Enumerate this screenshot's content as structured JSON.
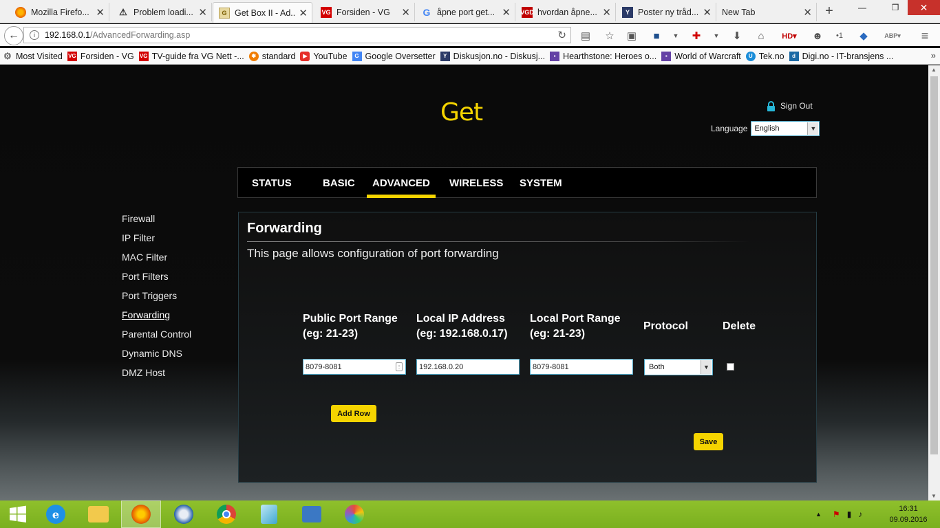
{
  "browser": {
    "tabs": [
      {
        "title": "Mozilla Firefo...",
        "favicon": "firefox-icon",
        "color": "#e66000"
      },
      {
        "title": "Problem loadi...",
        "favicon": "warning-icon",
        "color": "#f0c000"
      },
      {
        "title": "Get Box II - Ad...",
        "favicon": "get-icon",
        "color": "#e0c060"
      },
      {
        "title": "Forsiden - VG",
        "favicon": "vg-icon",
        "color": "#d30000"
      },
      {
        "title": "åpne port get...",
        "favicon": "google-icon",
        "color": "#4285f4"
      },
      {
        "title": "hvordan åpne...",
        "favicon": "vgd-icon",
        "color": "#c00000"
      },
      {
        "title": "Poster ny tråd...",
        "favicon": "diskusjon-icon",
        "color": "#2b3a67"
      },
      {
        "title": "New Tab",
        "favicon": "",
        "color": ""
      }
    ],
    "active_tab_index": 2,
    "url_host": "192.168.0.1",
    "url_path": "/AdvancedForwarding.asp",
    "bookmarks": [
      {
        "label": "Most Visited",
        "icon": "gear-icon",
        "color": "#666666"
      },
      {
        "label": "Forsiden - VG",
        "icon": "vg-icon",
        "color": "#d30000"
      },
      {
        "label": "TV-guide fra VG Nett -...",
        "icon": "vg-icon",
        "color": "#d30000"
      },
      {
        "label": "standard",
        "icon": "joomla-icon",
        "color": "#f07c00"
      },
      {
        "label": "YouTube",
        "icon": "youtube-icon",
        "color": "#e52d27"
      },
      {
        "label": "Google Oversetter",
        "icon": "translate-icon",
        "color": "#4285f4"
      },
      {
        "label": "Diskusjon.no - Diskusj...",
        "icon": "diskusjon-icon",
        "color": "#2b3a67"
      },
      {
        "label": "Hearthstone: Heroes o...",
        "icon": "twitch-icon",
        "color": "#6441a5"
      },
      {
        "label": "World of Warcraft",
        "icon": "twitch-icon",
        "color": "#6441a5"
      },
      {
        "label": "Tek.no",
        "icon": "tek-icon",
        "color": "#1a8cd8"
      },
      {
        "label": "Digi.no - IT-bransjens ...",
        "icon": "digi-icon",
        "color": "#1c6aa5"
      }
    ]
  },
  "router": {
    "sign_out": "Sign Out",
    "language_label": "Language",
    "language_value": "English",
    "main_tabs": [
      "STATUS",
      "BASIC",
      "ADVANCED",
      "WIRELESS",
      "SYSTEM"
    ],
    "active_main_tab": "ADVANCED",
    "sidebar": [
      "Firewall",
      "IP Filter",
      "MAC Filter",
      "Port Filters",
      "Port Triggers",
      "Forwarding",
      "Parental Control",
      "Dynamic DNS",
      "DMZ Host"
    ],
    "active_sidebar": "Forwarding",
    "page_title": "Forwarding",
    "page_description": "This page allows configuration of port forwarding",
    "columns": {
      "public_port": [
        "Public Port Range",
        "(eg: 21-23)"
      ],
      "local_ip": [
        "Local IP Address",
        "(eg: 192.168.0.17)"
      ],
      "local_port": [
        "Local Port Range",
        "(eg: 21-23)"
      ],
      "protocol": "Protocol",
      "delete": "Delete"
    },
    "row": {
      "public_port": "8079-8081",
      "local_ip": "192.168.0.20",
      "local_port": "8079-8081",
      "protocol": "Both",
      "delete_checked": false
    },
    "add_row_label": "Add Row",
    "save_label": "Save",
    "accent_color": "#f5d400"
  },
  "taskbar": {
    "apps": [
      "internet-explorer-icon",
      "file-explorer-icon",
      "firefox-icon",
      "thunderbird-icon",
      "chrome-icon",
      "notepad-icon",
      "control-panel-icon",
      "paint-icon"
    ],
    "active_app": "firefox-icon",
    "time": "16:31",
    "date": "09.09.2016"
  }
}
